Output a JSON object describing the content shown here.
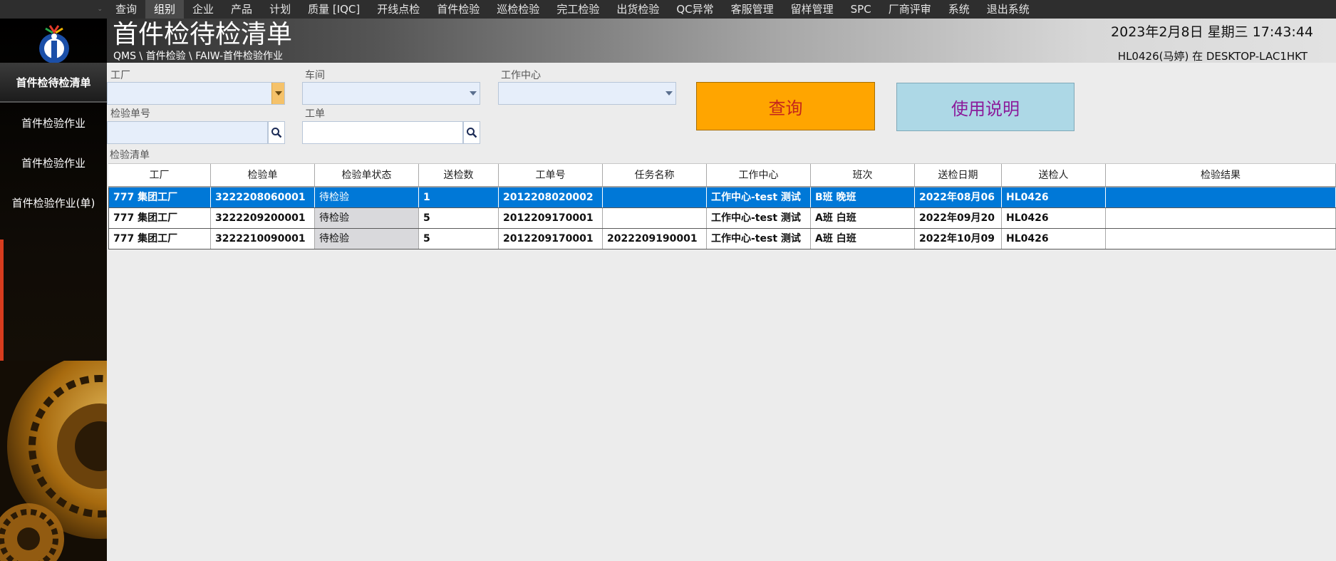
{
  "menu": {
    "items": [
      "查询",
      "组别",
      "企业",
      "产品",
      "计划",
      "质量 [IQC]",
      "开线点检",
      "首件检验",
      "巡检检验",
      "完工检验",
      "出货检验",
      "QC异常",
      "客服管理",
      "留样管理",
      "SPC",
      "厂商评审",
      "系统",
      "退出系统"
    ],
    "active_index": 1
  },
  "header": {
    "title": "首件检待检清单",
    "breadcrumb": "QMS \\ 首件检验 \\ FAIW-首件检验作业",
    "datetime": "2023年2月8日 星期三 17:43:44",
    "user": "HL0426(马婷) 在 DESKTOP-LAC1HKT"
  },
  "sidebar": {
    "items": [
      "首件检待检清单",
      "首件检验作业",
      "首件检验作业",
      "首件检验作业(单)"
    ],
    "active_index": 0
  },
  "filters": {
    "factory_label": "工厂",
    "workshop_label": "车间",
    "workcenter_label": "工作中心",
    "inspection_no_label": "检验单号",
    "work_order_label": "工单"
  },
  "buttons": {
    "query": "查询",
    "help": "使用说明"
  },
  "grid": {
    "section_label": "检验清单",
    "columns": [
      "工厂",
      "检验单",
      "检验单状态",
      "送检数",
      "工单号",
      "任务名称",
      "工作中心",
      "班次",
      "送检日期",
      "送检人",
      "检验结果"
    ],
    "rows": [
      [
        "777 集团工厂",
        "3222208060001",
        "待检验",
        "1",
        "2012208020002",
        "",
        "工作中心-test 测试",
        "B班 晚班",
        "2022年08月06",
        "HL0426",
        ""
      ],
      [
        "777 集团工厂",
        "3222209200001",
        "待检验",
        "5",
        "2012209170001",
        "",
        "工作中心-test 测试",
        "A班 白班",
        "2022年09月20",
        "HL0426",
        ""
      ],
      [
        "777 集团工厂",
        "3222210090001",
        "待检验",
        "5",
        "2012209170001",
        "2022209190001",
        "工作中心-test 测试",
        "A班 白班",
        "2022年10月09",
        "HL0426",
        ""
      ]
    ],
    "selected_row": 0
  },
  "colors": {
    "query_button": "#ffa500",
    "help_button": "#add8e6",
    "selected_row": "#0078d7"
  }
}
